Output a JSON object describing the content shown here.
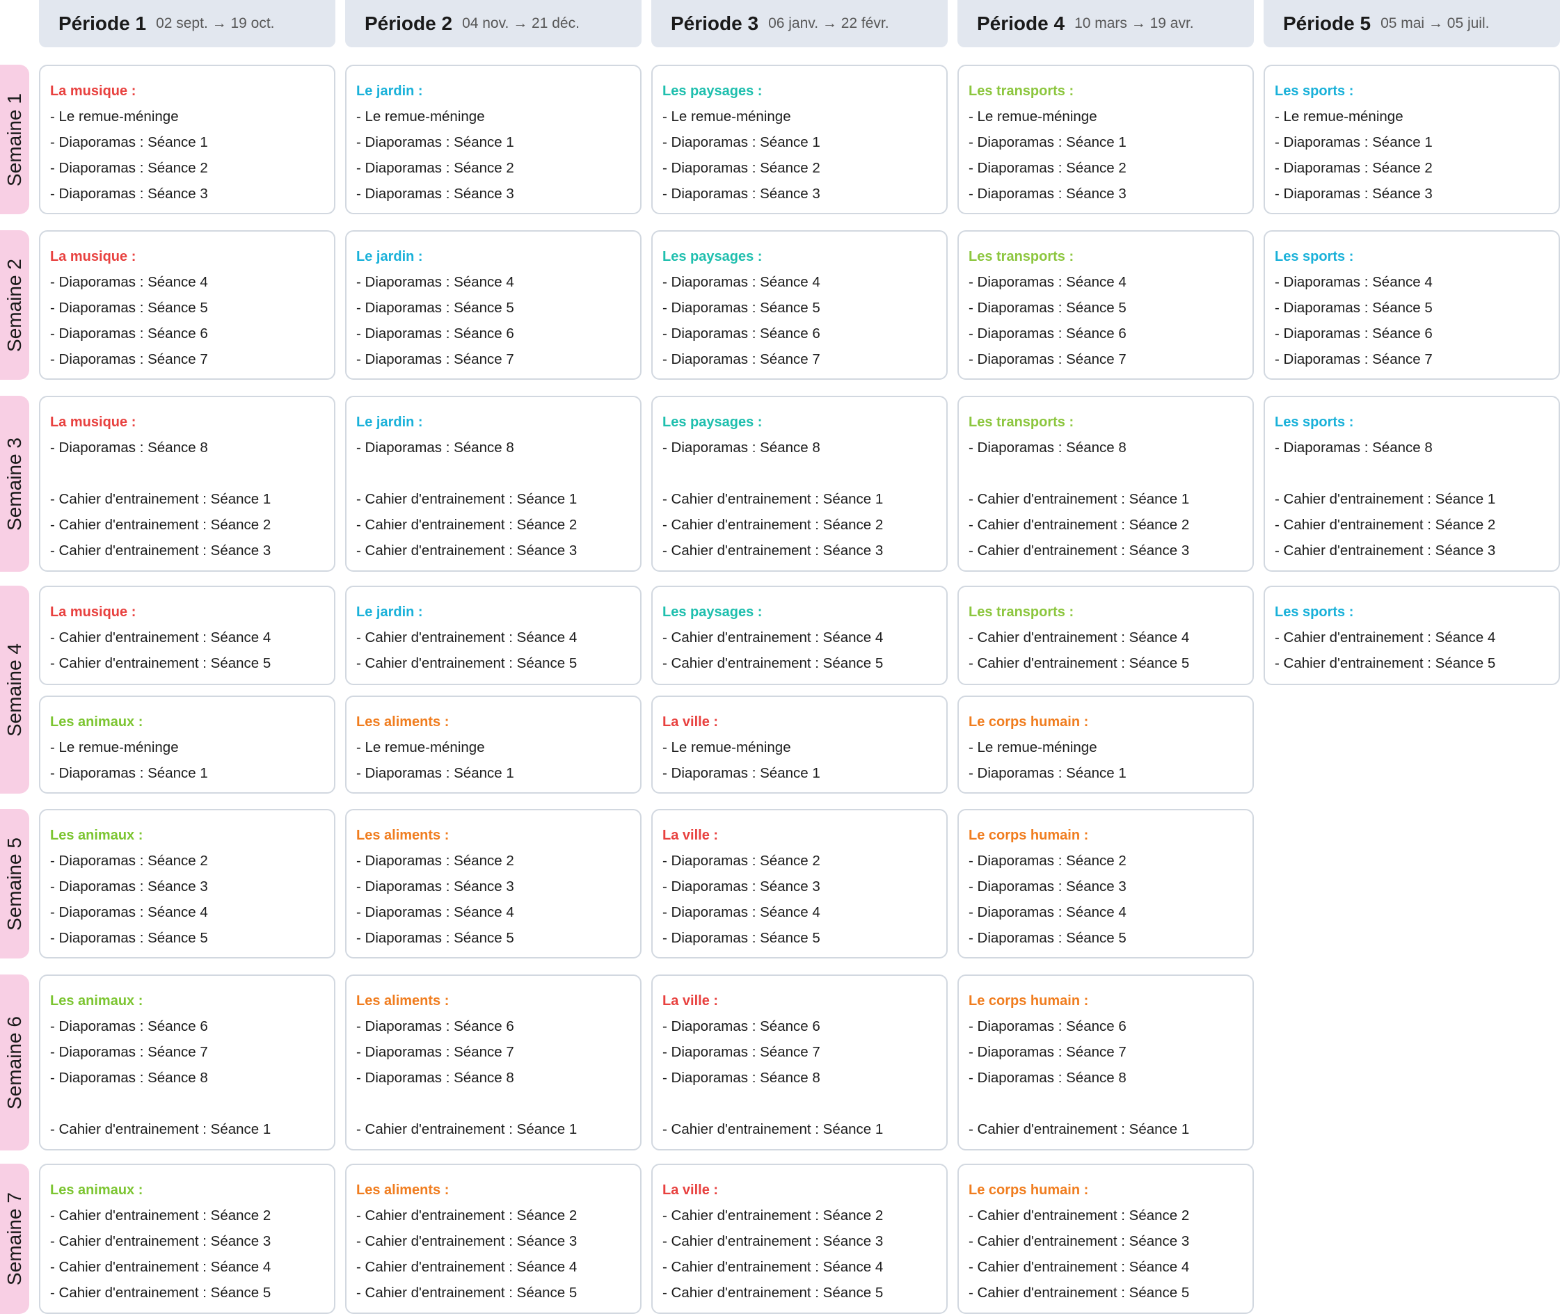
{
  "periods": [
    {
      "label": "Période 1",
      "dates": "02 sept. → 19 oct."
    },
    {
      "label": "Période 2",
      "dates": "04 nov. → 21 déc."
    },
    {
      "label": "Période 3",
      "dates": "06 janv. → 22 févr."
    },
    {
      "label": "Période 4",
      "dates": "10 mars → 19 avr."
    },
    {
      "label": "Période 5",
      "dates": "05 mai → 05 juil."
    }
  ],
  "weeks": [
    "Semaine 1",
    "Semaine 2",
    "Semaine 3",
    "Semaine 4",
    "Semaine 5",
    "Semaine 6",
    "Semaine 7"
  ],
  "themes": {
    "musique": {
      "label": "La musique :",
      "color": "#e8413f"
    },
    "jardin": {
      "label": "Le jardin :",
      "color": "#1ab1d9"
    },
    "paysages": {
      "label": "Les paysages :",
      "color": "#1fbfae"
    },
    "transports": {
      "label": "Les transports :",
      "color": "#8cc63e"
    },
    "sports": {
      "label": "Les sports :",
      "color": "#1ab1d9"
    },
    "animaux": {
      "label": "Les animaux :",
      "color": "#7cc531"
    },
    "aliments": {
      "label": "Les aliments :",
      "color": "#f07d1f"
    },
    "ville": {
      "label": "La ville :",
      "color": "#e8413f"
    },
    "corps": {
      "label": "Le corps humain :",
      "color": "#f07d1f"
    }
  },
  "blocks": {
    "A": [
      "- Le remue-méninge",
      "- Diaporamas : Séance 1",
      "- Diaporamas : Séance 2",
      "- Diaporamas : Séance 3"
    ],
    "B": [
      "- Diaporamas : Séance 4",
      "- Diaporamas : Séance 5",
      "- Diaporamas : Séance 6",
      "- Diaporamas : Séance 7"
    ],
    "C": [
      "- Diaporamas : Séance 8",
      "",
      "- Cahier d'entrainement : Séance 1",
      "- Cahier d'entrainement : Séance 2",
      "- Cahier d'entrainement : Séance 3"
    ],
    "D": [
      "- Cahier d'entrainement : Séance 4",
      "- Cahier d'entrainement : Séance 5"
    ],
    "E": [
      "- Le remue-méninge",
      "- Diaporamas : Séance 1"
    ],
    "F": [
      "- Diaporamas : Séance 2",
      "- Diaporamas : Séance 3",
      "- Diaporamas : Séance 4",
      "- Diaporamas : Séance 5"
    ],
    "G": [
      "- Diaporamas : Séance 6",
      "- Diaporamas : Séance 7",
      "- Diaporamas : Séance 8",
      "",
      "- Cahier d'entrainement : Séance 1"
    ],
    "H": [
      "- Cahier d'entrainement : Séance 2",
      "- Cahier d'entrainement : Séance 3",
      "- Cahier d'entrainement : Séance 4",
      "- Cahier d'entrainement : Séance 5"
    ]
  },
  "grid": [
    [
      {
        "theme": "musique",
        "block": "A"
      },
      {
        "theme": "jardin",
        "block": "A"
      },
      {
        "theme": "paysages",
        "block": "A"
      },
      {
        "theme": "transports",
        "block": "A"
      },
      {
        "theme": "sports",
        "block": "A"
      }
    ],
    [
      {
        "theme": "musique",
        "block": "B"
      },
      {
        "theme": "jardin",
        "block": "B"
      },
      {
        "theme": "paysages",
        "block": "B"
      },
      {
        "theme": "transports",
        "block": "B"
      },
      {
        "theme": "sports",
        "block": "B"
      }
    ],
    [
      {
        "theme": "musique",
        "block": "C"
      },
      {
        "theme": "jardin",
        "block": "C"
      },
      {
        "theme": "paysages",
        "block": "C"
      },
      {
        "theme": "transports",
        "block": "C"
      },
      {
        "theme": "sports",
        "block": "C"
      }
    ],
    [
      {
        "theme": "musique",
        "block": "D"
      },
      {
        "theme": "jardin",
        "block": "D"
      },
      {
        "theme": "paysages",
        "block": "D"
      },
      {
        "theme": "transports",
        "block": "D"
      },
      {
        "theme": "sports",
        "block": "D"
      }
    ],
    [
      {
        "theme": "animaux",
        "block": "E"
      },
      {
        "theme": "aliments",
        "block": "E"
      },
      {
        "theme": "ville",
        "block": "E"
      },
      {
        "theme": "corps",
        "block": "E"
      },
      null
    ],
    [
      {
        "theme": "animaux",
        "block": "F"
      },
      {
        "theme": "aliments",
        "block": "F"
      },
      {
        "theme": "ville",
        "block": "F"
      },
      {
        "theme": "corps",
        "block": "F"
      },
      null
    ],
    [
      {
        "theme": "animaux",
        "block": "G"
      },
      {
        "theme": "aliments",
        "block": "G"
      },
      {
        "theme": "ville",
        "block": "G"
      },
      {
        "theme": "corps",
        "block": "G"
      },
      null
    ],
    [
      {
        "theme": "animaux",
        "block": "H"
      },
      {
        "theme": "aliments",
        "block": "H"
      },
      {
        "theme": "ville",
        "block": "H"
      },
      {
        "theme": "corps",
        "block": "H"
      },
      null
    ]
  ]
}
